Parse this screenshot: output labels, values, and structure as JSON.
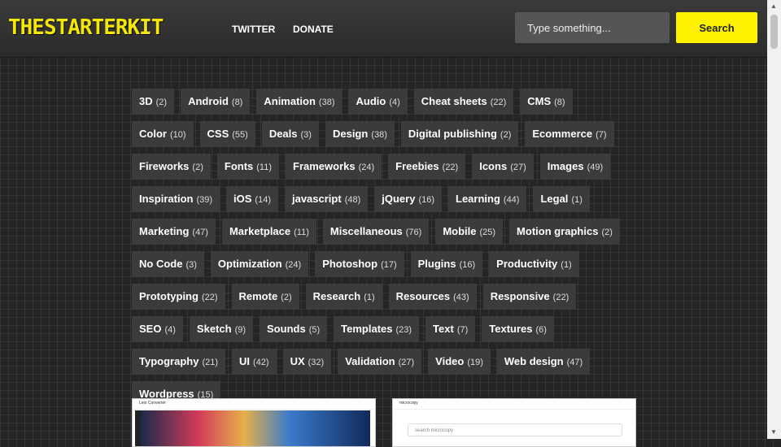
{
  "header": {
    "logo": "THESTARTERKIT",
    "nav": [
      "TWITTER",
      "DONATE"
    ],
    "search": {
      "placeholder": "Type something...",
      "button": "Search"
    }
  },
  "tags": [
    {
      "label": "3D",
      "count": "(2)"
    },
    {
      "label": "Android",
      "count": "(8)"
    },
    {
      "label": "Animation",
      "count": "(38)"
    },
    {
      "label": "Audio",
      "count": "(4)"
    },
    {
      "label": "Cheat sheets",
      "count": "(22)"
    },
    {
      "label": "CMS",
      "count": "(8)"
    },
    {
      "label": "Color",
      "count": "(10)"
    },
    {
      "label": "CSS",
      "count": "(55)"
    },
    {
      "label": "Deals",
      "count": "(3)"
    },
    {
      "label": "Design",
      "count": "(38)"
    },
    {
      "label": "Digital publishing",
      "count": "(2)"
    },
    {
      "label": "Ecommerce",
      "count": "(7)"
    },
    {
      "label": "Fireworks",
      "count": "(2)"
    },
    {
      "label": "Fonts",
      "count": "(11)"
    },
    {
      "label": "Frameworks",
      "count": "(24)"
    },
    {
      "label": "Freebies",
      "count": "(22)"
    },
    {
      "label": "Icons",
      "count": "(27)"
    },
    {
      "label": "Images",
      "count": "(49)"
    },
    {
      "label": "Inspiration",
      "count": "(39)"
    },
    {
      "label": "iOS",
      "count": "(14)"
    },
    {
      "label": "javascript",
      "count": "(48)"
    },
    {
      "label": "jQuery",
      "count": "(16)"
    },
    {
      "label": "Learning",
      "count": "(44)"
    },
    {
      "label": "Legal",
      "count": "(1)"
    },
    {
      "label": "Marketing",
      "count": "(47)"
    },
    {
      "label": "Marketplace",
      "count": "(11)"
    },
    {
      "label": "Miscellaneous",
      "count": "(76)"
    },
    {
      "label": "Mobile",
      "count": "(25)"
    },
    {
      "label": "Motion graphics",
      "count": "(2)"
    },
    {
      "label": "No Code",
      "count": "(3)"
    },
    {
      "label": "Optimization",
      "count": "(24)"
    },
    {
      "label": "Photoshop",
      "count": "(17)"
    },
    {
      "label": "Plugins",
      "count": "(16)"
    },
    {
      "label": "Productivity",
      "count": "(1)"
    },
    {
      "label": "Prototyping",
      "count": "(22)"
    },
    {
      "label": "Remote",
      "count": "(2)"
    },
    {
      "label": "Research",
      "count": "(1)"
    },
    {
      "label": "Resources",
      "count": "(43)"
    },
    {
      "label": "Responsive",
      "count": "(22)"
    },
    {
      "label": "SEO",
      "count": "(4)"
    },
    {
      "label": "Sketch",
      "count": "(9)"
    },
    {
      "label": "Sounds",
      "count": "(5)"
    },
    {
      "label": "Templates",
      "count": "(23)"
    },
    {
      "label": "Text",
      "count": "(7)"
    },
    {
      "label": "Textures",
      "count": "(6)"
    },
    {
      "label": "Typography",
      "count": "(21)"
    },
    {
      "label": "UI",
      "count": "(42)"
    },
    {
      "label": "UX",
      "count": "(32)"
    },
    {
      "label": "Validation",
      "count": "(27)"
    },
    {
      "label": "Video",
      "count": "(19)"
    },
    {
      "label": "Web design",
      "count": "(47)"
    },
    {
      "label": "Wordpress",
      "count": "(15)"
    }
  ],
  "cards": {
    "card1_brand": "Leio Converter",
    "card2_brand": "microcopy",
    "card2_search": "search microcopy"
  },
  "colors": {
    "accent": "#fff200",
    "background": "#252525",
    "tag_bg": "#3b3b3b"
  }
}
